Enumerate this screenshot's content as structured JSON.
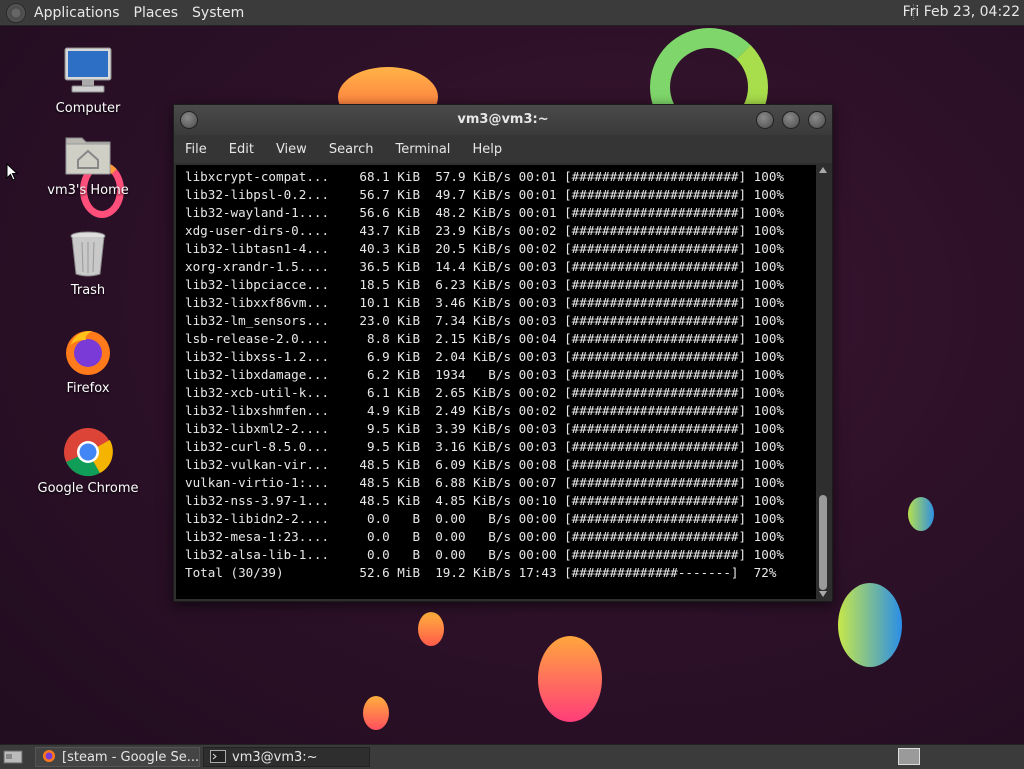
{
  "top_panel": {
    "menus": [
      "Applications",
      "Places",
      "System"
    ],
    "clock": "Fri Feb 23, 04:22"
  },
  "desktop_icons": [
    {
      "label": "Computer",
      "icon": "computer-icon"
    },
    {
      "label": "vm3's Home",
      "icon": "home-folder-icon"
    },
    {
      "label": "Trash",
      "icon": "trash-icon"
    },
    {
      "label": "Firefox",
      "icon": "firefox-icon"
    },
    {
      "label": "Google Chrome",
      "icon": "chrome-icon"
    }
  ],
  "window": {
    "title": "vm3@vm3:~",
    "menu": [
      "File",
      "Edit",
      "View",
      "Search",
      "Terminal",
      "Help"
    ]
  },
  "terminal": {
    "lines": [
      "libxcrypt-compat...    68.1 KiB  57.9 KiB/s 00:01 [######################] 100%",
      "lib32-libpsl-0.2...    56.7 KiB  49.7 KiB/s 00:01 [######################] 100%",
      "lib32-wayland-1....    56.6 KiB  48.2 KiB/s 00:01 [######################] 100%",
      "xdg-user-dirs-0....    43.7 KiB  23.9 KiB/s 00:02 [######################] 100%",
      "lib32-libtasn1-4...    40.3 KiB  20.5 KiB/s 00:02 [######################] 100%",
      "xorg-xrandr-1.5....    36.5 KiB  14.4 KiB/s 00:03 [######################] 100%",
      "lib32-libpciacce...    18.5 KiB  6.23 KiB/s 00:03 [######################] 100%",
      "lib32-libxxf86vm...    10.1 KiB  3.46 KiB/s 00:03 [######################] 100%",
      "lib32-lm_sensors...    23.0 KiB  7.34 KiB/s 00:03 [######################] 100%",
      "lsb-release-2.0....     8.8 KiB  2.15 KiB/s 00:04 [######################] 100%",
      "lib32-libxss-1.2...     6.9 KiB  2.04 KiB/s 00:03 [######################] 100%",
      "lib32-libxdamage...     6.2 KiB  1934   B/s 00:03 [######################] 100%",
      "lib32-xcb-util-k...     6.1 KiB  2.65 KiB/s 00:02 [######################] 100%",
      "lib32-libxshmfen...     4.9 KiB  2.49 KiB/s 00:02 [######################] 100%",
      "lib32-libxml2-2....     9.5 KiB  3.39 KiB/s 00:03 [######################] 100%",
      "lib32-curl-8.5.0...     9.5 KiB  3.16 KiB/s 00:03 [######################] 100%",
      "lib32-vulkan-vir...    48.5 KiB  6.09 KiB/s 00:08 [######################] 100%",
      "vulkan-virtio-1:...    48.5 KiB  6.88 KiB/s 00:07 [######################] 100%",
      "lib32-nss-3.97-1...    48.5 KiB  4.85 KiB/s 00:10 [######################] 100%",
      "lib32-libidn2-2....     0.0   B  0.00   B/s 00:00 [######################] 100%",
      "lib32-mesa-1:23....     0.0   B  0.00   B/s 00:00 [######################] 100%",
      "lib32-alsa-lib-1...     0.0   B  0.00   B/s 00:00 [######################] 100%",
      "Total (30/39)          52.6 MiB  19.2 KiB/s 17:43 [##############-------]  72%"
    ]
  },
  "taskbar": {
    "tasks": [
      {
        "label": "[steam - Google Se...",
        "icon": "firefox-icon",
        "active": false
      },
      {
        "label": "vm3@vm3:~",
        "icon": "terminal-icon",
        "active": true
      }
    ]
  },
  "colors": {
    "panel": "#3b3b3b",
    "terminal_bg": "#000000",
    "terminal_fg": "#e8e8e8",
    "desktop_bg": "#2b1027"
  }
}
